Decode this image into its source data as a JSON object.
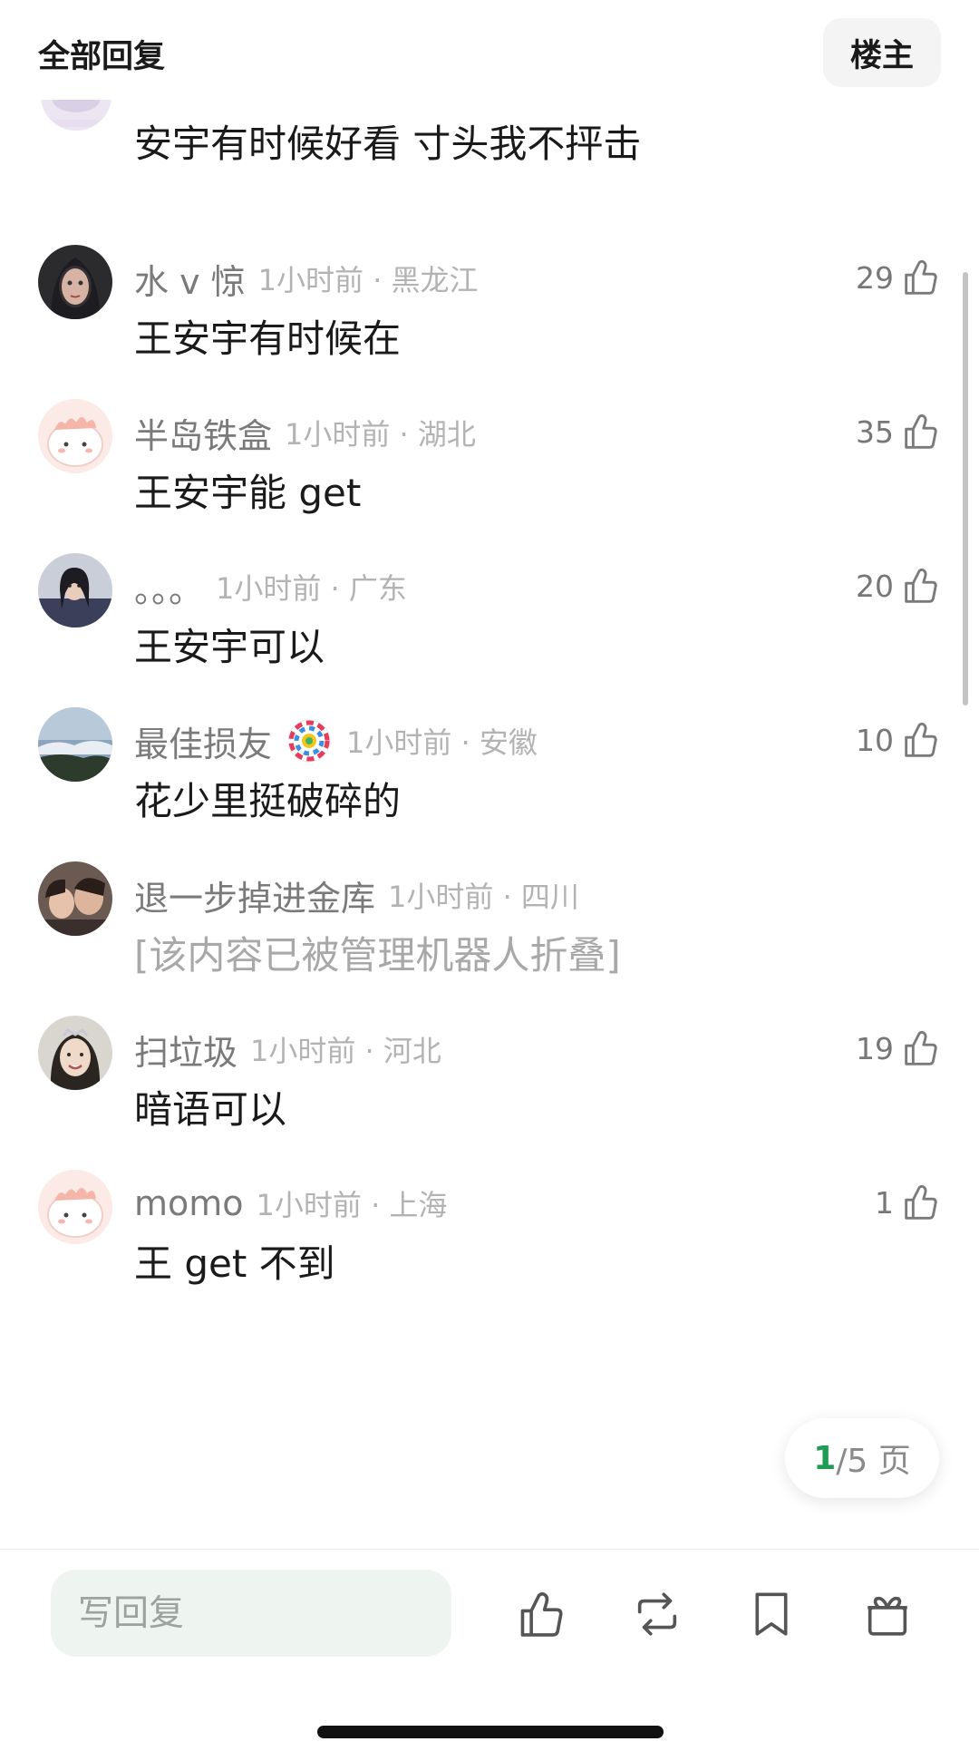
{
  "header": {
    "title": "全部回复",
    "op_button": "楼主"
  },
  "partial_comment": {
    "text": "安宇有时候好看 寸头我不抨击"
  },
  "comments": [
    {
      "name": "水 v 惊",
      "time": "1小时前 · 黑龙江",
      "text": "王安宇有时候在",
      "likes": "29"
    },
    {
      "name": "半岛铁盒",
      "time": "1小时前 · 湖北",
      "text": "王安宇能 get",
      "likes": "35"
    },
    {
      "name": "。。。",
      "time": "1小时前 · 广东",
      "text": "王安宇可以",
      "likes": "20"
    },
    {
      "name": "最佳损友",
      "time": "1小时前 · 安徽",
      "text": "花少里挺破碎的",
      "likes": "10"
    },
    {
      "name": "退一步掉进金库",
      "time": "1小时前 · 四川",
      "text": "[该内容已被管理机器人折叠]",
      "likes": ""
    },
    {
      "name": "扫垃圾",
      "time": "1小时前 · 河北",
      "text": "暗语可以",
      "likes": "19"
    },
    {
      "name": "momo",
      "time": "1小时前 · 上海",
      "text": "王 get 不到",
      "likes": "1"
    }
  ],
  "pager": {
    "current": "1",
    "rest": "/5 页"
  },
  "bottom": {
    "reply_placeholder": "写回复"
  },
  "colors": {
    "accent": "#1f9d55",
    "meta": "#b3b3b3",
    "name": "#7a7a7a"
  }
}
